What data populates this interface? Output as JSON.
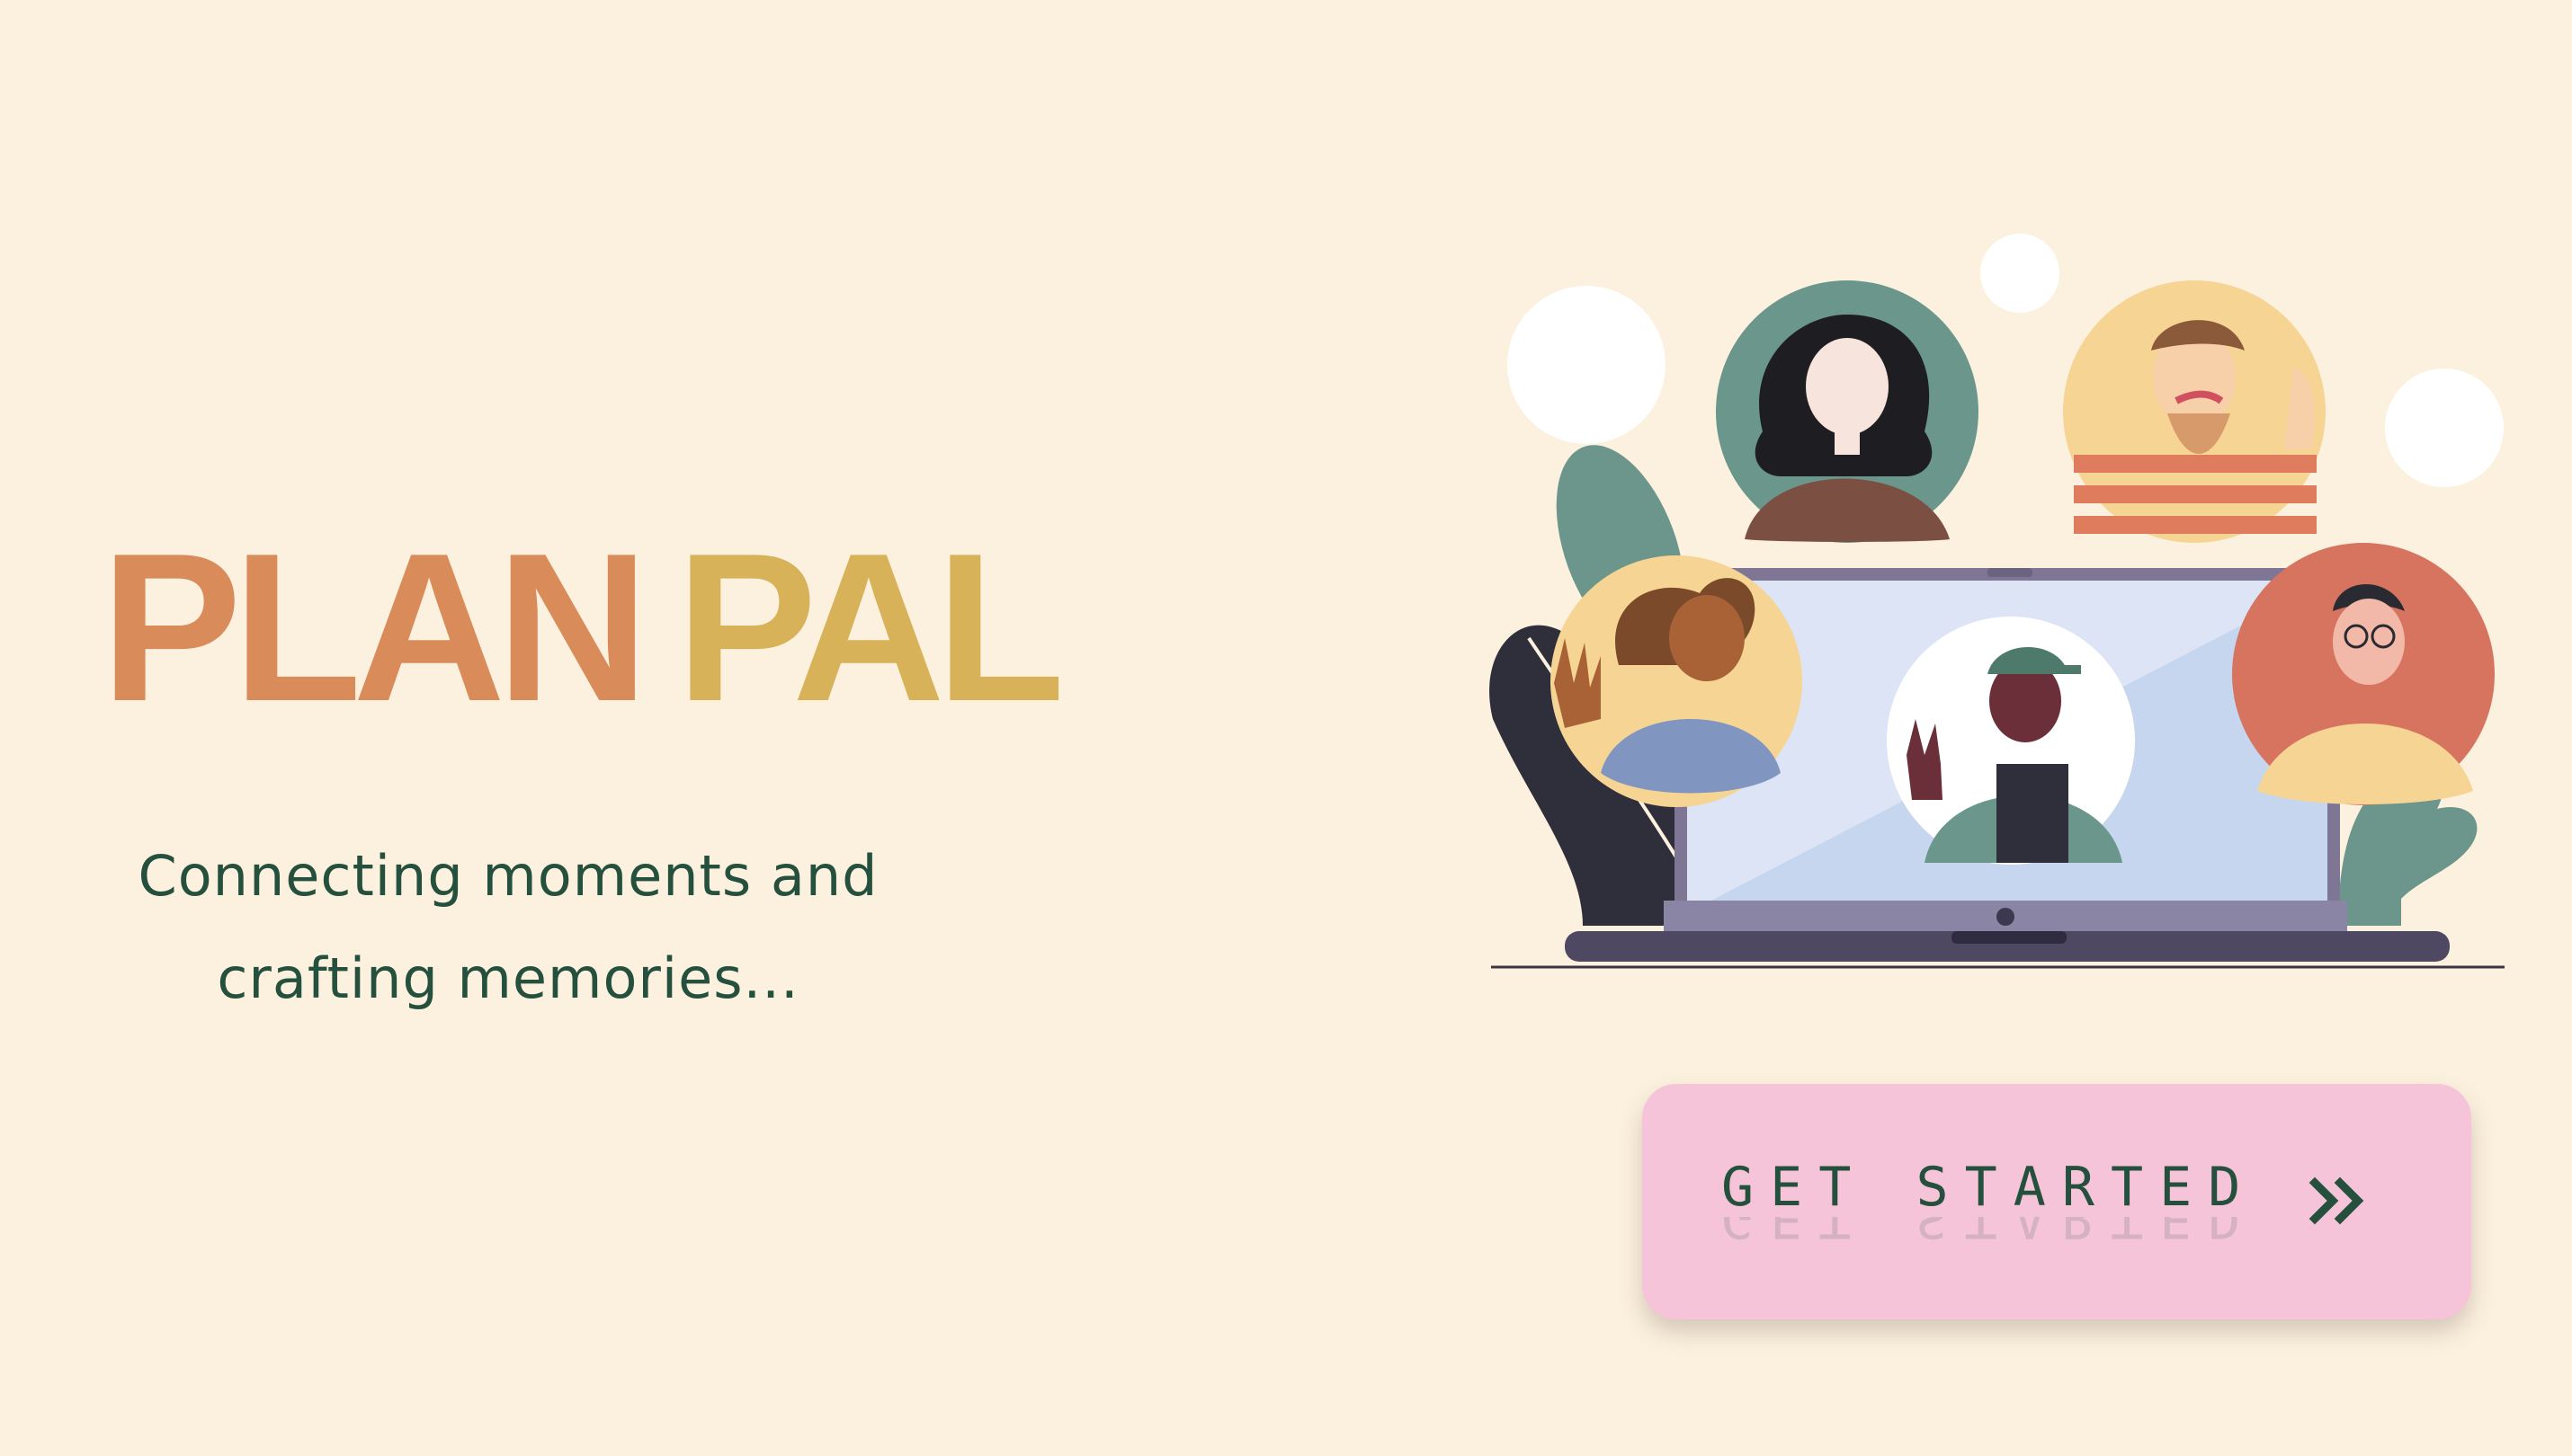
{
  "brand": {
    "plan": "PLAN",
    "pal": "PAL"
  },
  "tagline": {
    "line1": "Connecting moments and",
    "line2": "crafting memories..."
  },
  "cta": {
    "label": "GET STARTED",
    "icon": "double-chevron-right-icon"
  },
  "illustration": {
    "description_icon": "video-call-illustration"
  },
  "colors": {
    "background": "#fcf1de",
    "plan": "#d98b5a",
    "pal": "#d8b258",
    "text": "#24503d",
    "button": "#f5c4d8"
  }
}
